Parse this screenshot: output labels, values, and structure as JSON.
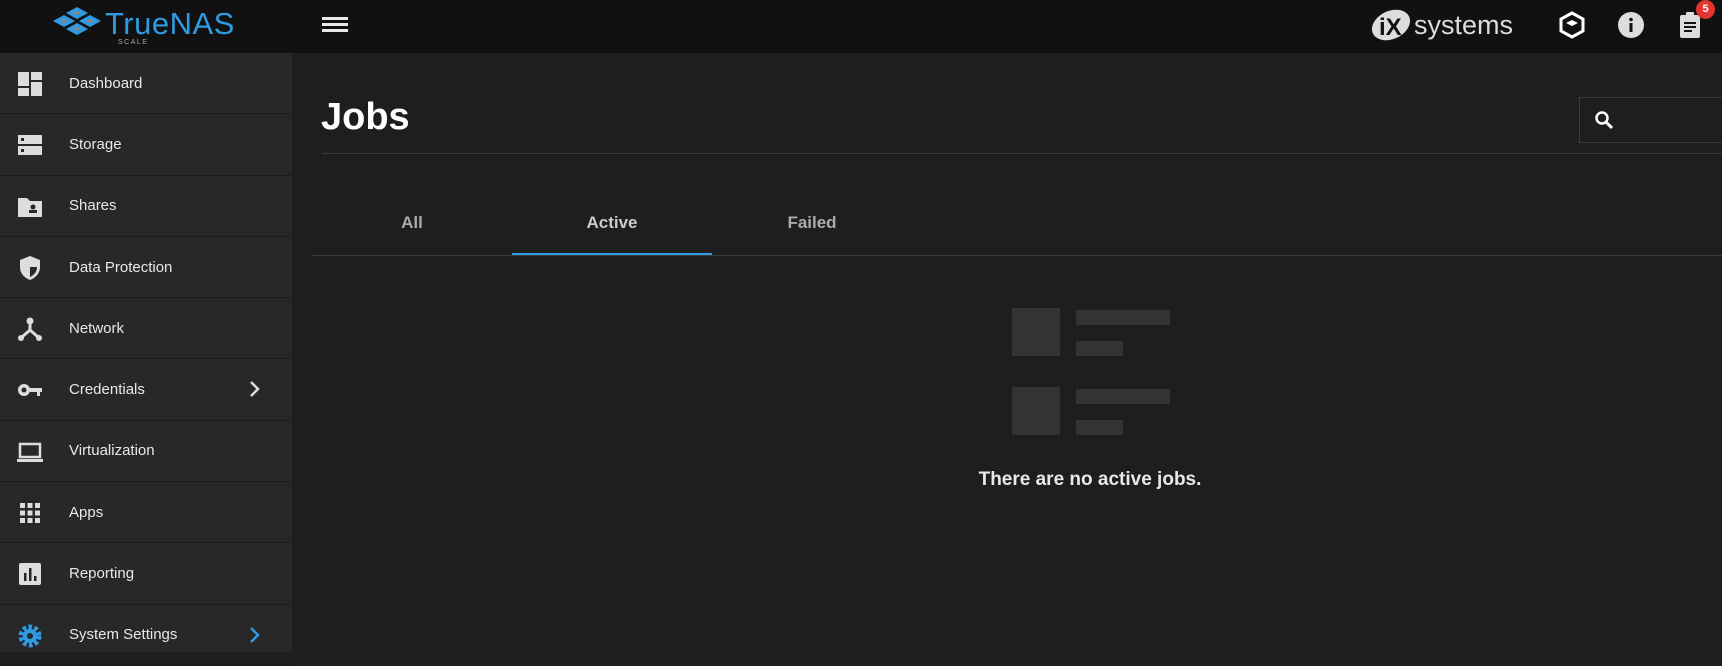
{
  "header": {
    "logo_text": "TrueNAS",
    "logo_sub": "SCALE",
    "vendor_text": "systems",
    "notification_count": "5"
  },
  "sidebar": {
    "items": [
      {
        "label": "Dashboard",
        "icon": "dashboard-icon"
      },
      {
        "label": "Storage",
        "icon": "storage-icon"
      },
      {
        "label": "Shares",
        "icon": "folder-shared-icon"
      },
      {
        "label": "Data Protection",
        "icon": "shield-icon"
      },
      {
        "label": "Network",
        "icon": "network-icon"
      },
      {
        "label": "Credentials",
        "icon": "key-icon",
        "has_submenu": true
      },
      {
        "label": "Virtualization",
        "icon": "laptop-icon"
      },
      {
        "label": "Apps",
        "icon": "apps-grid-icon"
      },
      {
        "label": "Reporting",
        "icon": "chart-icon"
      },
      {
        "label": "System Settings",
        "icon": "gear-icon",
        "has_submenu": true,
        "accent": "#2e9be3"
      }
    ]
  },
  "main": {
    "title": "Jobs",
    "search": {
      "placeholder": "",
      "value": ""
    },
    "tabs": [
      {
        "label": "All"
      },
      {
        "label": "Active",
        "selected": true
      },
      {
        "label": "Failed"
      }
    ],
    "empty_message": "There are no active jobs."
  },
  "colors": {
    "accent": "#2e9be3",
    "badge": "#e3342f",
    "sidebar": "#282828",
    "topbar": "#111111"
  }
}
